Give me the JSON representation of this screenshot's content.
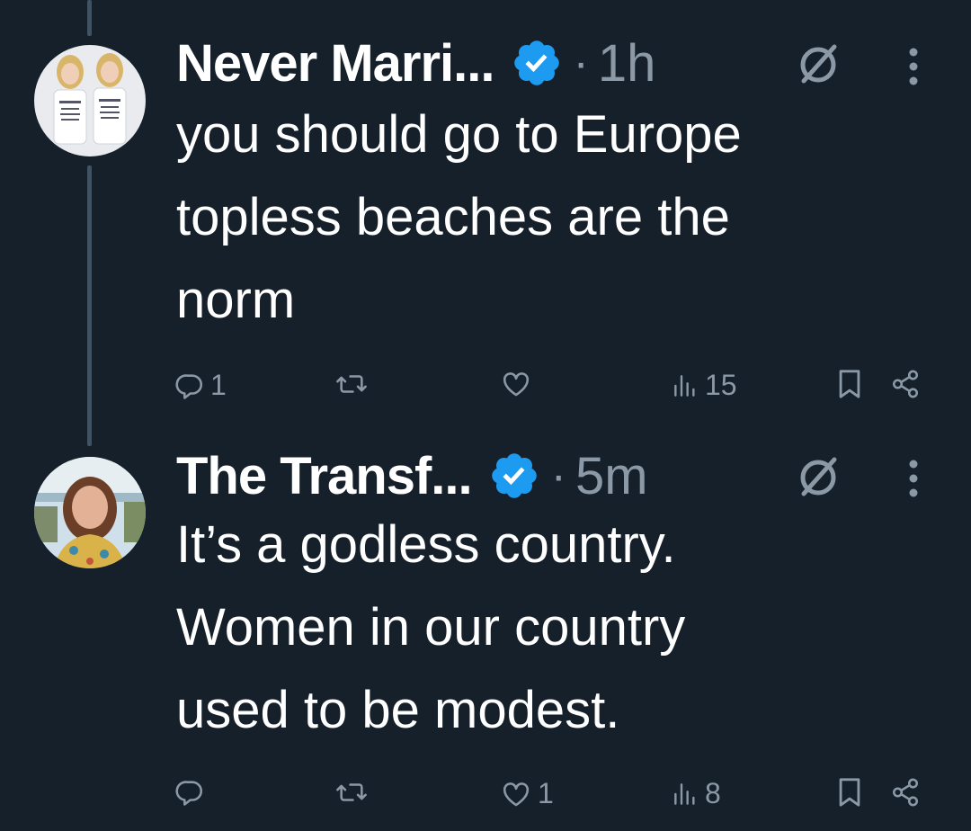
{
  "tweets": [
    {
      "display_name": "Never Marri...",
      "separator": "·",
      "time": "1h",
      "body_lines": [
        "you should go to Europe",
        "topless beaches are the",
        "norm"
      ],
      "replies": "1",
      "retweets": "",
      "likes": "",
      "views": "15",
      "icons": [
        "verified-badge-icon",
        "grok-icon",
        "more-icon",
        "reply-icon",
        "retweet-icon",
        "like-icon",
        "views-icon",
        "bookmark-icon",
        "share-icon"
      ]
    },
    {
      "display_name": "The Transf...",
      "separator": "·",
      "time": "5m",
      "body_lines": [
        "It’s a godless country.",
        "Women in our country",
        "used to be modest."
      ],
      "replies": "",
      "retweets": "",
      "likes": "1",
      "views": "8",
      "icons": [
        "verified-badge-icon",
        "grok-icon",
        "more-icon",
        "reply-icon",
        "retweet-icon",
        "like-icon",
        "views-icon",
        "bookmark-icon",
        "share-icon"
      ]
    }
  ],
  "colors": {
    "background": "#15202b",
    "text": "#ffffff",
    "muted": "#8b98a5",
    "verified": "#1d9bf0",
    "thread_line": "#3d5466"
  }
}
